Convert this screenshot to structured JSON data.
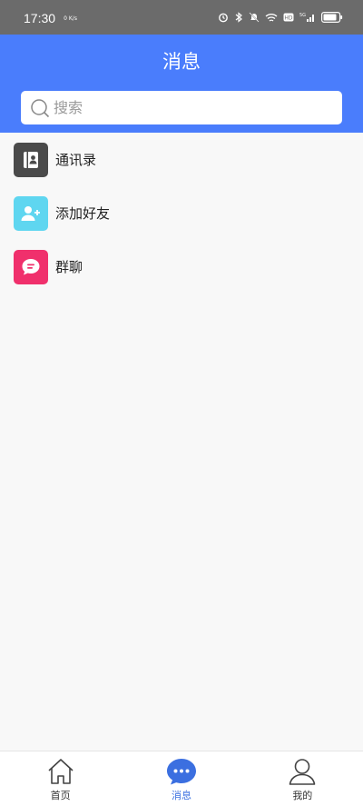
{
  "status_bar": {
    "time": "17:30",
    "net_speed": "0 K/s",
    "battery": "",
    "network": "5G"
  },
  "header": {
    "title": "消息"
  },
  "search": {
    "placeholder": "搜索"
  },
  "menu": [
    {
      "label": "通讯录",
      "icon": "contacts-icon",
      "color": "#4a4a4a"
    },
    {
      "label": "添加好友",
      "icon": "add-friend-icon",
      "color": "#5fd6f0"
    },
    {
      "label": "群聊",
      "icon": "group-chat-icon",
      "color": "#f0306c"
    }
  ],
  "bottom_nav": {
    "items": [
      {
        "label": "首页",
        "icon": "home-icon"
      },
      {
        "label": "消息",
        "icon": "message-icon",
        "active": true
      },
      {
        "label": "我的",
        "icon": "profile-icon"
      }
    ]
  },
  "colors": {
    "accent": "#4a7dfc",
    "active_nav": "#3b6fe0"
  }
}
